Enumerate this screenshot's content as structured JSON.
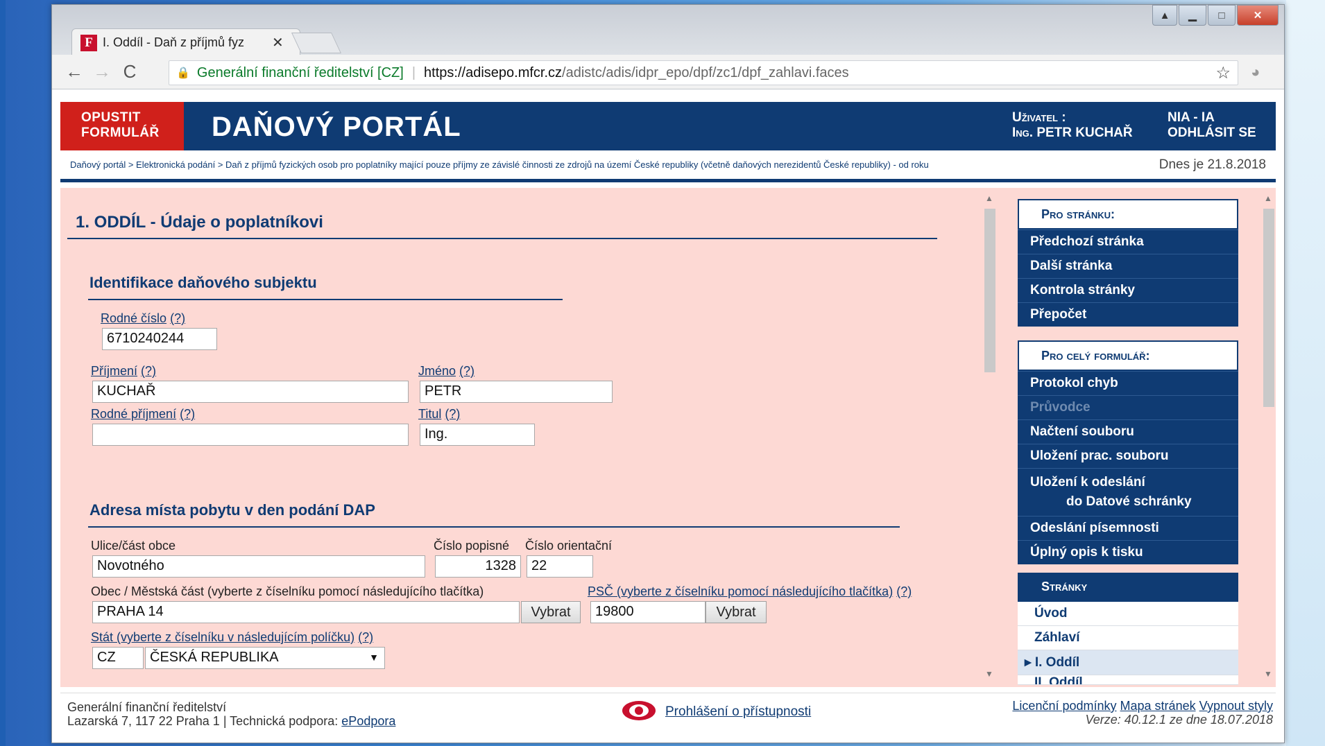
{
  "browser": {
    "tab_title": "I. Oddíl - Daň z příjmů fyz",
    "tab_close": "✕",
    "back": "←",
    "forward": "→",
    "reload": "C",
    "secure_label": "Generální finanční ředitelství [CZ]",
    "url_host": "https://adisepo.mfcr.cz",
    "url_path": "/adistc/adis/idpr_epo/dpf/zc1/dpf_zahlavi.faces",
    "icons": [
      "lock-icon",
      "star-icon",
      "extension-icon",
      "menu-icon"
    ]
  },
  "header": {
    "exit_line1": "OPUSTIT",
    "exit_line2": "FORMULÁŘ",
    "title": "DAŇOVÝ PORTÁL",
    "user_label": "Uživatel :",
    "user_name": "Ing. PETR KUCHAŘ",
    "nia": "NIA - IA",
    "logout": "ODHLÁSIT SE"
  },
  "breadcrumb": {
    "text": "Daňový portál > Elektronická podání > Daň z příjmů fyzických osob pro poplatníky mající pouze příjmy ze závislé činnosti ze zdrojů na území České republiky (včetně daňových nerezidentů České republiky) - od roku",
    "today": "Dnes je 21.8.2018"
  },
  "form": {
    "section_title": "1. ODDÍL - Údaje o poplatníkovi",
    "ident_title": "Identifikace daňového subjektu",
    "rodne_cislo_label": "Rodné číslo",
    "help": "(?)",
    "rodne_cislo": "6710240244",
    "prijmeni_label": "Příjmení",
    "prijmeni": "KUCHAŘ",
    "jmeno_label": "Jméno",
    "jmeno": "PETR",
    "rodne_prijmeni_label": "Rodné příjmení",
    "rodne_prijmeni": "",
    "titul_label": "Titul",
    "titul": "Ing.",
    "address_title": "Adresa místa pobytu v den podání DAP",
    "ulice_label": "Ulice/část obce",
    "ulice": "Novotného",
    "cislo_popisne_label": "Číslo popisné",
    "cislo_popisne": "1328",
    "cislo_orientacni_label": "Číslo orientační",
    "cislo_orientacni": "22",
    "obec_label": "Obec / Městská část (vyberte z číselníku pomocí následujícího tlačítka)",
    "obec": "PRAHA 14",
    "vybrat": "Vybrat",
    "psc_label": "PSČ (vyberte z číselníku pomocí následujícího tlačítka)",
    "psc": "19800",
    "stat_label": "Stát (vyberte z číselníku v následujícím políčku)",
    "stat_code": "CZ",
    "stat_name": "ČESKÁ REPUBLIKA"
  },
  "sidebar": {
    "page_head": "Pro stránku:",
    "page_items": [
      "Předchozí stránka",
      "Další stránka",
      "Kontrola stránky",
      "Přepočet"
    ],
    "form_head": "Pro celý formulář:",
    "form_items": [
      "Protokol chyb",
      "Průvodce",
      "Načtení souboru",
      "Uložení prac. souboru"
    ],
    "save_send_line1": "Uložení k odeslání",
    "save_send_line2": "do Datové schránky",
    "form_items2": [
      "Odeslání písemnosti",
      "Úplný opis k tisku"
    ],
    "pages_head": "Stránky",
    "pages": [
      "Úvod",
      "Záhlaví",
      "I. Oddíl",
      "II. Oddíl"
    ]
  },
  "footer": {
    "org": "Generální finanční ředitelství",
    "address": "Lazarská 7, 117 22 Praha 1 | Technická podpora:",
    "support_link": "ePodpora",
    "accessibility": "Prohlášení o přístupnosti",
    "license": "Licenční podmínky",
    "sitemap": "Mapa stránek",
    "styles_off": "Vypnout styly",
    "version": "Verze: 40.12.1 ze dne 18.07.2018"
  },
  "colors": {
    "navy": "#0f3b73",
    "red": "#d0201b",
    "form_bg": "#fdd9d4"
  }
}
